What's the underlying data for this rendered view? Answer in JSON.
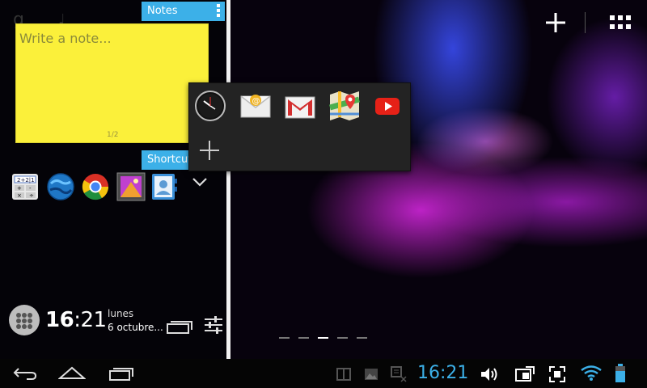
{
  "notes_widget": {
    "title": "Notes",
    "placeholder": "Write a note...",
    "page_indicator": "1/2"
  },
  "shortcuts_widget": {
    "title": "Shortcuts"
  },
  "dock_icons": [
    "calculator-icon",
    "browser-icon",
    "chrome-icon",
    "gallery-icon",
    "contacts-icon"
  ],
  "popup_apps": [
    "clock-icon",
    "email-icon",
    "gmail-icon",
    "maps-icon",
    "youtube-icon"
  ],
  "clock_widget": {
    "hours": "16",
    "minutes": ":21",
    "day": "lunes",
    "date": "6 octubre..."
  },
  "status_bar": {
    "time": "16:21"
  },
  "colors": {
    "accent": "#3cb0e8",
    "note": "#fbf03a"
  },
  "workspace": {
    "page_count": 5,
    "active_page": 3
  }
}
